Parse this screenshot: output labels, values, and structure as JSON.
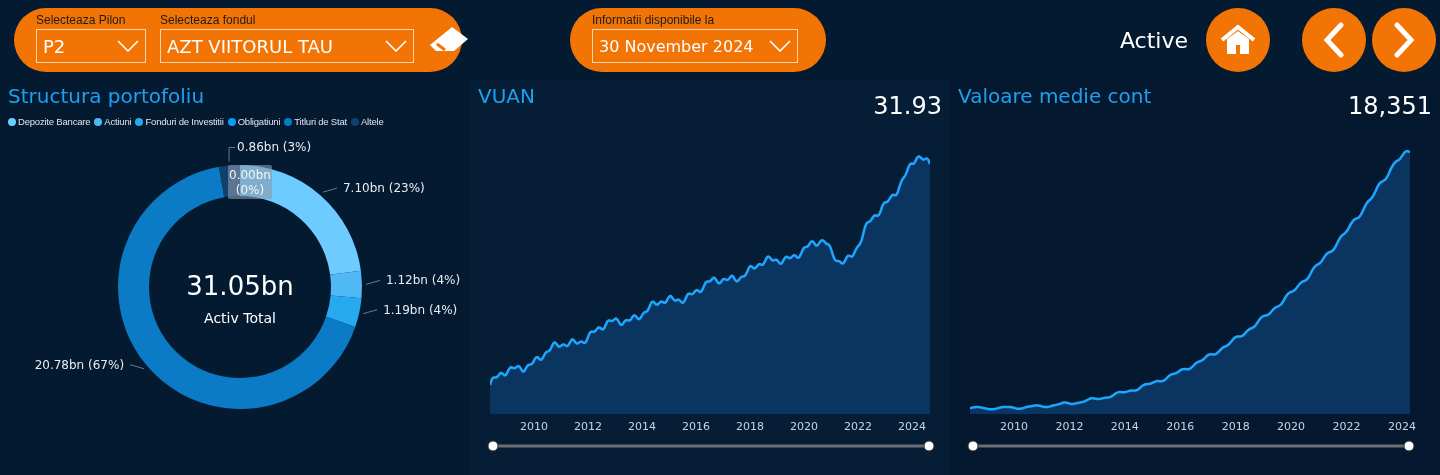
{
  "filters": [
    {
      "label": "Selecteaza Pilon",
      "value": "P2"
    },
    {
      "label": "Selecteaza fondul",
      "value": "AZT VIITORUL TAU"
    }
  ],
  "date_filter": {
    "label": "Informatii disponibile la",
    "value": "30 November 2024"
  },
  "page_title": "Active",
  "portfolio": {
    "title": "Structura portofoliu",
    "center_value": "31.05bn",
    "center_label": "Activ Total",
    "chart_data": {
      "type": "donut",
      "categories": [
        "Depozite Bancare",
        "Actiuni",
        "Fonduri de Investitii",
        "Obligatiuni",
        "Titluri de Stat",
        "Altele"
      ],
      "colors": [
        "#6ecbff",
        "#4fb8f5",
        "#27a9f0",
        "#0a9cf0",
        "#0a7bc4",
        "#123f6b"
      ],
      "values": [
        22.87,
        3.61,
        3.83,
        0.0,
        66.92,
        2.77
      ],
      "value_labels": [
        "7.10bn (23%)",
        "1.12bn (4%)",
        "1.19bn (4%)",
        "0.00bn (0%)",
        "20.78bn (67%)",
        "0.86bn (3%)"
      ]
    }
  },
  "charts": [
    {
      "title": "VUAN",
      "value": "31.93",
      "kind": "vuan",
      "x_labels": [
        "2010",
        "2012",
        "2014",
        "2016",
        "2018",
        "2020",
        "2022",
        "2024"
      ],
      "slider": {
        "level": 1
      }
    },
    {
      "title": "Valoare medie cont",
      "value": "18,351",
      "kind": "cont",
      "x_labels": [
        "2010",
        "2012",
        "2014",
        "2016",
        "2018",
        "2020",
        "2022",
        "2024"
      ],
      "slider": {
        "level": 1
      }
    }
  ]
}
